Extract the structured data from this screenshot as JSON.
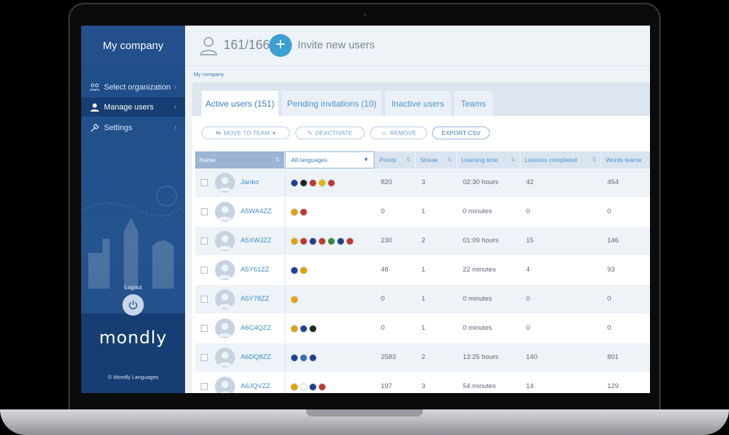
{
  "sidebar": {
    "company": "My company",
    "items": [
      {
        "label": "Select organization",
        "icon": "organization-icon"
      },
      {
        "label": "Manage users",
        "icon": "user-icon",
        "active": true
      },
      {
        "label": "Settings",
        "icon": "wrench-icon"
      }
    ],
    "logout_label": "Logout",
    "brand": "mondly",
    "copyright": "© Mondly Languages"
  },
  "header": {
    "user_count": "161/166",
    "invite_label": "Invite new users"
  },
  "breadcrumb": "My company",
  "tabs": [
    {
      "label": "Active users (151)",
      "active": true
    },
    {
      "label": "Pending invitations (10)"
    },
    {
      "label": "Inactive users"
    },
    {
      "label": "Teams"
    }
  ],
  "actions": {
    "move_to_team": "MOVE TO TEAM",
    "deactivate": "DEACTIVATE",
    "remove": "REMOVE",
    "export_csv": "EXPORT CSV"
  },
  "table": {
    "columns": {
      "name": "Name",
      "languages": "All languages",
      "points": "Points",
      "streak": "Streak",
      "learning_time": "Learning time",
      "lessons": "Lessons completed",
      "words": "Words learne"
    },
    "rows": [
      {
        "name": "Janko",
        "flags": [
          "#1f3f8f",
          "#222",
          "#c0392b",
          "#e6b800",
          "#c0392b"
        ],
        "points": "820",
        "streak": "3",
        "time": "02:30 hours",
        "lessons": "42",
        "words": "454"
      },
      {
        "name": "A5WA4ZZ",
        "flags": [
          "#e6a000",
          "#c0392b"
        ],
        "points": "0",
        "streak": "1",
        "time": "0 minutes",
        "lessons": "0",
        "words": "0"
      },
      {
        "name": "A5XWJZZ",
        "flags": [
          "#e6a000",
          "#c0392b",
          "#1f3f8f",
          "#c0392b",
          "#2e8b3a",
          "#1f3f8f",
          "#c0392b"
        ],
        "points": "230",
        "streak": "2",
        "time": "01:09 hours",
        "lessons": "15",
        "words": "146"
      },
      {
        "name": "A5Y61ZZ",
        "flags": [
          "#1f3f8f",
          "#e6a000"
        ],
        "points": "48",
        "streak": "1",
        "time": "22 minutes",
        "lessons": "4",
        "words": "93"
      },
      {
        "name": "A5Y78ZZ",
        "flags": [
          "#e6a000"
        ],
        "points": "0",
        "streak": "1",
        "time": "0 minutes",
        "lessons": "0",
        "words": "0"
      },
      {
        "name": "A6C4QZZ",
        "flags": [
          "#e6a000",
          "#1f3f8f",
          "#222"
        ],
        "points": "0",
        "streak": "1",
        "time": "0 minutes",
        "lessons": "0",
        "words": "0"
      },
      {
        "name": "A6DQ8ZZ",
        "flags": [
          "#1f3f8f",
          "#2e6fb0",
          "#1f3f8f"
        ],
        "points": "2583",
        "streak": "2",
        "time": "13:25 hours",
        "lessons": "140",
        "words": "801"
      },
      {
        "name": "A6JQVZZ",
        "flags": [
          "#e6a000",
          "#ffffff",
          "#1f3f8f",
          "#c0392b"
        ],
        "points": "197",
        "streak": "3",
        "time": "54 minutes",
        "lessons": "14",
        "words": "129"
      }
    ]
  },
  "colors": {
    "sidebar": "#1e4c87",
    "accent": "#3b9fd0",
    "link": "#3a8ec9"
  }
}
